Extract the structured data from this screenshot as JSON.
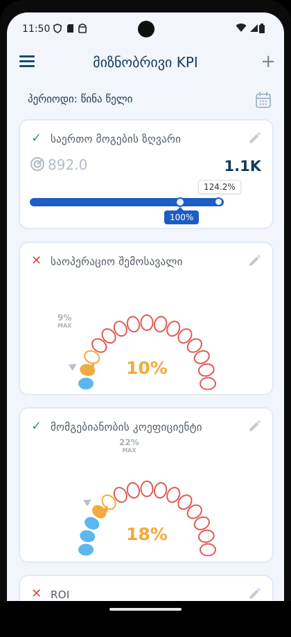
{
  "status_bar": {
    "time": "11:50"
  },
  "app_bar": {
    "title": "მიზნობრივი KPI"
  },
  "period": {
    "label": "პერიოდი: წინა წელი"
  },
  "colors": {
    "accent": "#1d5dc4",
    "ok": "#2e9e5b",
    "fail": "#e0463b",
    "amber": "#f2aa3c",
    "blue": "#5cb6f0",
    "red_outline": "#e05a56"
  },
  "cards": [
    {
      "status": "met",
      "title": "საერთო მოგების ზღვარი",
      "current": "892.0",
      "target": "1.1K",
      "tooltip_value": "124.2%",
      "tooltip_target": "100%",
      "progress_fraction": 1.242
    },
    {
      "status": "not-met",
      "title": "საოპერაციო შემოსავალი",
      "percent": "10%",
      "max_label": "9%",
      "max_sub": "MAX",
      "value_pct": 10,
      "max_pct": 9
    },
    {
      "status": "met",
      "title": "მომგებიანობის კოეფიციენტი",
      "percent": "18%",
      "max_label": "22%",
      "max_sub": "MAX",
      "value_pct": 18,
      "max_pct": 22
    },
    {
      "status": "not-met",
      "title": "ROI"
    }
  ]
}
